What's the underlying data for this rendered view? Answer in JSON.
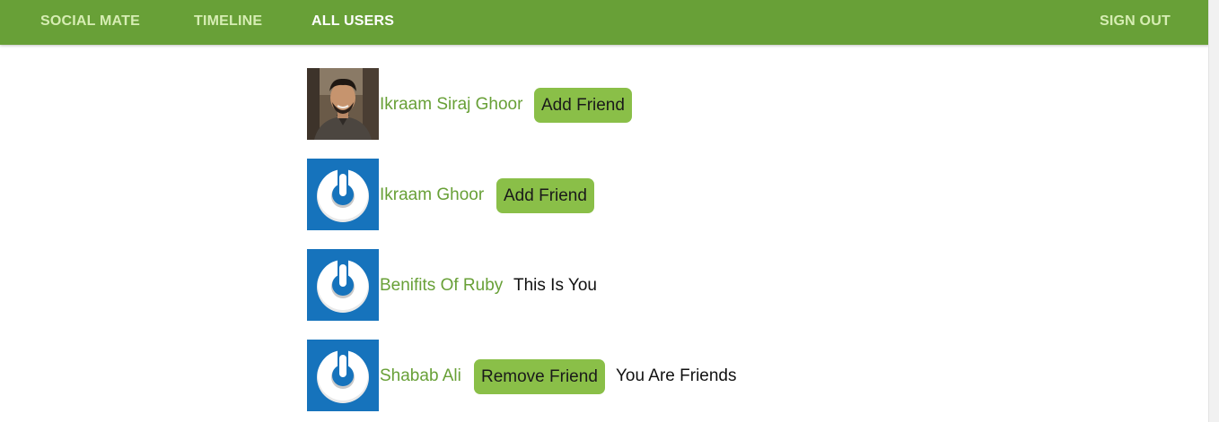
{
  "nav": {
    "brand": "SOCIAL MATE",
    "timeline": "TIMELINE",
    "all_users": "ALL USERS",
    "sign_out": "SIGN OUT"
  },
  "colors": {
    "navbar": "#68a037",
    "link": "#68a037",
    "button": "#8abf48",
    "avatar_bg": "#1673bc"
  },
  "users": [
    {
      "name": "Ikraam Siraj Ghoor",
      "avatar": "photo",
      "action": "Add Friend",
      "status": ""
    },
    {
      "name": "Ikraam Ghoor",
      "avatar": "default-power-icon",
      "action": "Add Friend",
      "status": ""
    },
    {
      "name": "Benifits Of Ruby",
      "avatar": "default-power-icon",
      "action": "",
      "status": "This Is You"
    },
    {
      "name": "Shabab Ali",
      "avatar": "default-power-icon",
      "action": "Remove Friend",
      "status": "You Are Friends"
    }
  ]
}
